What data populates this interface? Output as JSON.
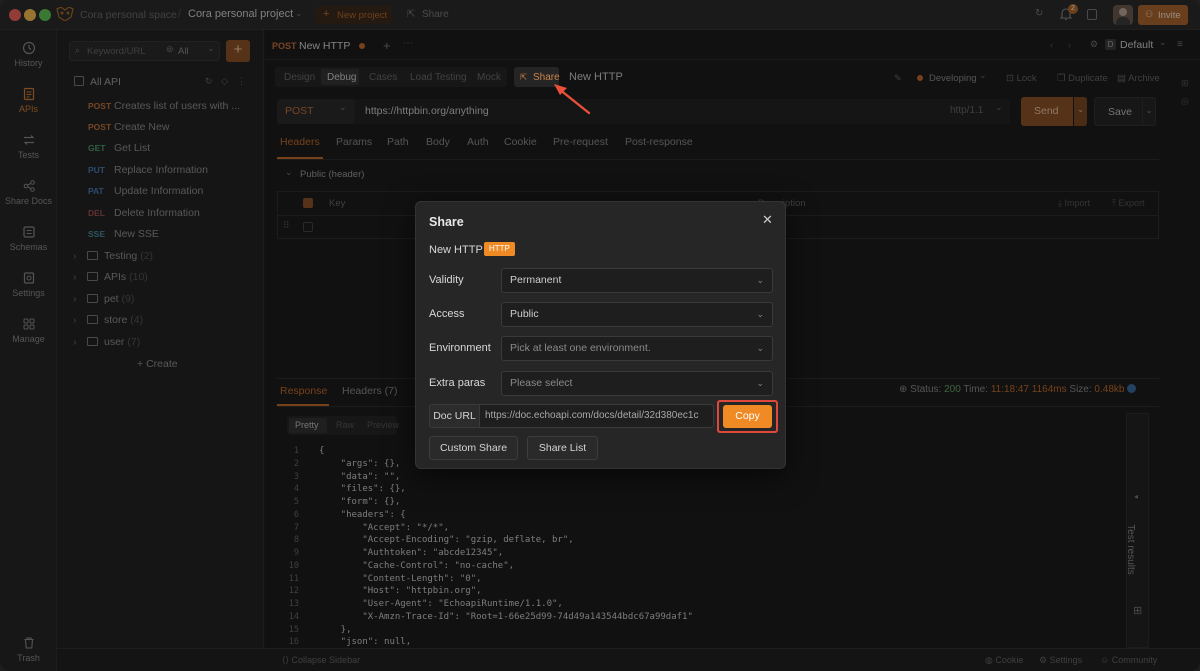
{
  "titlebar": {
    "workspace": "Cora personal space",
    "project": "Cora personal project",
    "new_project": "New project",
    "share": "Share",
    "notification_count": "2",
    "invite": "Invite"
  },
  "rail": {
    "items": [
      {
        "label": "History",
        "icon": "clock-icon"
      },
      {
        "label": "APIs",
        "icon": "doc-icon"
      },
      {
        "label": "Tests",
        "icon": "arrows-icon"
      },
      {
        "label": "Share Docs",
        "icon": "share-icon"
      },
      {
        "label": "Schemas",
        "icon": "db-icon"
      },
      {
        "label": "Settings",
        "icon": "gear-icon"
      },
      {
        "label": "Manage",
        "icon": "grid-icon"
      }
    ],
    "trash": "Trash"
  },
  "sidebar": {
    "search_placeholder": "Keyword/URL",
    "filter": "All",
    "root": "All API",
    "apis": [
      {
        "method": "POST",
        "name": "Creates list of users with ..."
      },
      {
        "method": "POST",
        "name": "Create New"
      },
      {
        "method": "GET",
        "name": "Get List"
      },
      {
        "method": "PUT",
        "name": "Replace Information"
      },
      {
        "method": "PAT",
        "name": "Update Information"
      },
      {
        "method": "DEL",
        "name": "Delete Information"
      },
      {
        "method": "SSE",
        "name": "New SSE"
      }
    ],
    "folders": [
      {
        "name": "Testing",
        "count": "(2)"
      },
      {
        "name": "APIs",
        "count": "(10)"
      },
      {
        "name": "pet",
        "count": "(9)"
      },
      {
        "name": "store",
        "count": "(4)"
      },
      {
        "name": "user",
        "count": "(7)"
      }
    ],
    "create": "Create",
    "collapse": "Collapse Sidebar"
  },
  "main": {
    "tab_method": "POST",
    "tab_name": "New HTTP",
    "env": "Default",
    "subtabs": [
      "Design",
      "Debug",
      "Cases",
      "Load Testing",
      "Mock"
    ],
    "share_tab": "Share",
    "title": "New HTTP",
    "status": "Developing",
    "lock": "Lock",
    "duplicate": "Duplicate",
    "archive": "Archive",
    "method": "POST",
    "url": "https://httpbin.org/anything",
    "protocol": "http/1.1",
    "send": "Send",
    "save": "Save",
    "req_tabs": [
      "Headers",
      "Params",
      "Path",
      "Body",
      "Auth",
      "Cookie",
      "Pre-request",
      "Post-response"
    ],
    "public_header": "Public  (header)",
    "col_key": "Key",
    "col_desc": "Description",
    "import": "Import",
    "export": "Export",
    "resp_tabs": [
      "Response",
      "Headers (7)"
    ],
    "resp_status_label": "Status:",
    "resp_status": "200",
    "resp_time_label": "Time:",
    "resp_time": "11:18:47",
    "resp_ms": "1164ms",
    "resp_size_label": "Size:",
    "resp_size": "0.48kb",
    "view_tabs": [
      "Pretty",
      "Raw",
      "Preview"
    ],
    "test_results": "Test results",
    "code_lines": [
      "{",
      "    \"args\": {},",
      "    \"data\": \"\",",
      "    \"files\": {},",
      "    \"form\": {},",
      "    \"headers\": {",
      "        \"Accept\": \"*/*\",",
      "        \"Accept-Encoding\": \"gzip, deflate, br\",",
      "        \"Authtoken\": \"abcde12345\",",
      "        \"Cache-Control\": \"no-cache\",",
      "        \"Content-Length\": \"0\",",
      "        \"Host\": \"httpbin.org\",",
      "        \"User-Agent\": \"EchoapiRuntime/1.1.0\",",
      "        \"X-Amzn-Trace-Id\": \"Root=1-66e25d99-74d49a143544bdc67a99daf1\"",
      "    },",
      "    \"json\": null,"
    ],
    "line_numbers": [
      "1",
      "2",
      "3",
      "4",
      "5",
      "6",
      "7",
      "8",
      "9",
      "10",
      "11",
      "12",
      "13",
      "14",
      "15",
      "16"
    ]
  },
  "footer": {
    "cookie": "Cookie",
    "settings": "Settings",
    "community": "Community"
  },
  "modal": {
    "title": "Share",
    "api_name": "New HTTP",
    "badge": "HTTP",
    "validity_label": "Validity",
    "validity": "Permanent",
    "access_label": "Access",
    "access": "Public",
    "environment_label": "Environment",
    "environment_placeholder": "Pick at least one environment.",
    "extra_label": "Extra paras",
    "extra_placeholder": "Please select",
    "doc_url_label": "Doc URL",
    "doc_url": "https://doc.echoapi.com/docs/detail/32d380ec1c",
    "copy": "Copy",
    "custom_share": "Custom Share",
    "share_list": "Share List"
  },
  "colors": {
    "accent": "#f08a24",
    "highlight_box": "#e0483b",
    "arrow": "#e8503a"
  }
}
